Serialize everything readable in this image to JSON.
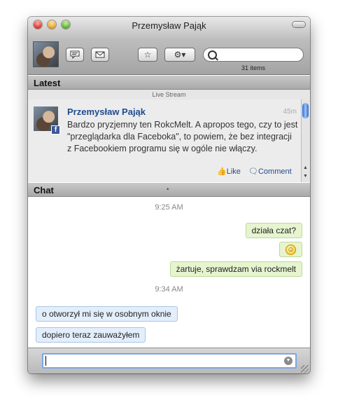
{
  "window": {
    "title": "Przemysław Pająk"
  },
  "toolbar": {
    "chat_icon": "chat-bubble-icon",
    "mail_icon": "envelope-icon",
    "star_label": "☆",
    "gear_label": "⚙▾",
    "search_placeholder": "",
    "items_count": "31 items"
  },
  "latest": {
    "title": "Latest",
    "stream_label": "Live Stream",
    "post": {
      "author": "Przemysław Pająk",
      "time": "45m",
      "text": "Bardzo pryzjemny ten RokcMelt. A apropos tego, czy to jest \"przeglądarka dla Faceboka\", to powiem, że bez integracji z Facebookiem programu się w ogóle nie włączy.",
      "like_label": "Like",
      "comment_label": "Comment"
    }
  },
  "chat": {
    "title": "Chat",
    "stamp1": "9:25 AM",
    "msg1": "działa czat?",
    "msg2": "☺",
    "msg3": "żartuje, sprawdzam via rockmelt",
    "stamp2": "9:34 AM",
    "msg4": "o otworzył mi się w osobnym oknie",
    "msg5": "dopiero teraz zauważyłem"
  },
  "composer": {
    "value": ""
  },
  "colors": {
    "link": "#1f4b8f",
    "outgoing_bubble": "#e6f4cf",
    "incoming_bubble": "#e3eefb",
    "focus_ring": "#7aa7e6"
  }
}
